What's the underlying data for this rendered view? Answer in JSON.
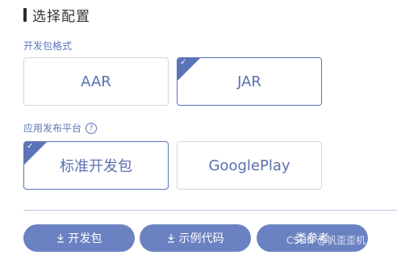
{
  "section": {
    "title": "选择配置"
  },
  "package_format": {
    "label": "开发包格式",
    "options": [
      {
        "label": "AAR",
        "selected": false
      },
      {
        "label": "JAR",
        "selected": true
      }
    ]
  },
  "platform": {
    "label": "应用发布平台",
    "help_icon": "?",
    "options": [
      {
        "label": "标准开发包",
        "selected": true
      },
      {
        "label": "GooglePlay",
        "selected": false
      }
    ]
  },
  "actions": {
    "download_sdk": "开发包",
    "sample_code": "示例代码",
    "reference": "类参考"
  },
  "watermark": "CSDN @帆歪歪机",
  "colors": {
    "accent": "#5b73b8",
    "button": "#6b82c2",
    "label": "#5b78b8"
  }
}
